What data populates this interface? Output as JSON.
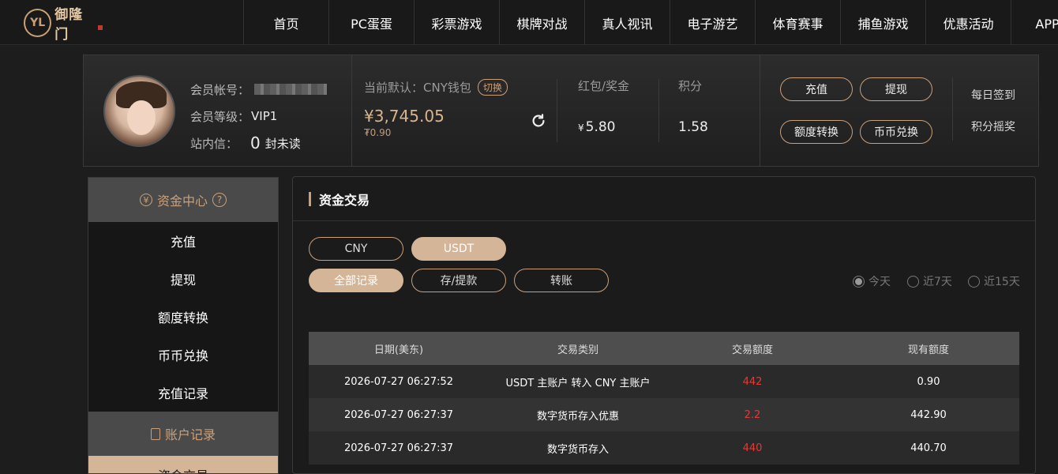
{
  "brand": {
    "logo_mark": "YL",
    "name": "御隆门"
  },
  "nav": {
    "items": [
      "首页",
      "PC蛋蛋",
      "彩票游戏",
      "棋牌对战",
      "真人视讯",
      "电子游艺",
      "体育赛事",
      "捕鱼游戏",
      "优惠活动",
      "APP下"
    ]
  },
  "user": {
    "account_label": "会员帐号：",
    "level_label": "会员等级：",
    "level_value": "VIP1",
    "inbox_label": "站内信：",
    "inbox_count": "0",
    "inbox_unit": "封未读"
  },
  "wallet": {
    "default_label": "当前默认：CNY钱包",
    "switch_label": "切换",
    "amount": "¥3,745.05",
    "sub_amount": "₮0.90",
    "refresh_icon": "refresh-icon"
  },
  "stats": {
    "bonus_label": "红包/奖金",
    "bonus_currency": "¥",
    "bonus_value": "5.80",
    "points_label": "积分",
    "points_value": "1.58"
  },
  "actions": {
    "deposit": "充值",
    "withdraw": "提现",
    "transfer": "额度转换",
    "exchange": "币币兑换",
    "daily_signin": "每日签到",
    "points_lottery": "积分摇奖"
  },
  "sidebar": {
    "section1_title": "资金中心",
    "section1_icon": "yuan-circle-icon",
    "help_icon": "?",
    "items1": [
      "充值",
      "提现",
      "额度转换",
      "币币兑换",
      "充值记录"
    ],
    "section2_title": "账户记录",
    "section2_icon": "document-icon",
    "items2": [
      "资金交易"
    ]
  },
  "main": {
    "title": "资金交易",
    "currency_tabs": [
      "CNY",
      "USDT"
    ],
    "active_currency": "USDT",
    "type_tabs": [
      "全部记录",
      "存/提款",
      "转账"
    ],
    "active_type": "全部记录",
    "ranges": [
      "今天",
      "近7天",
      "近15天"
    ],
    "active_range": "今天",
    "table": {
      "headers": [
        "日期(美东)",
        "交易类别",
        "交易额度",
        "现有额度"
      ],
      "rows": [
        [
          "2026-07-27 06:27:52",
          "USDT 主账户 转入 CNY 主账户",
          "442",
          "0.90"
        ],
        [
          "2026-07-27 06:27:37",
          "数字货币存入优惠",
          "2.2",
          "442.90"
        ],
        [
          "2026-07-27 06:27:37",
          "数字货币存入",
          "440",
          "440.70"
        ]
      ]
    }
  },
  "colors": {
    "accent": "#c9a07a",
    "active_fill": "#d4b598",
    "negative": "#e53935"
  }
}
